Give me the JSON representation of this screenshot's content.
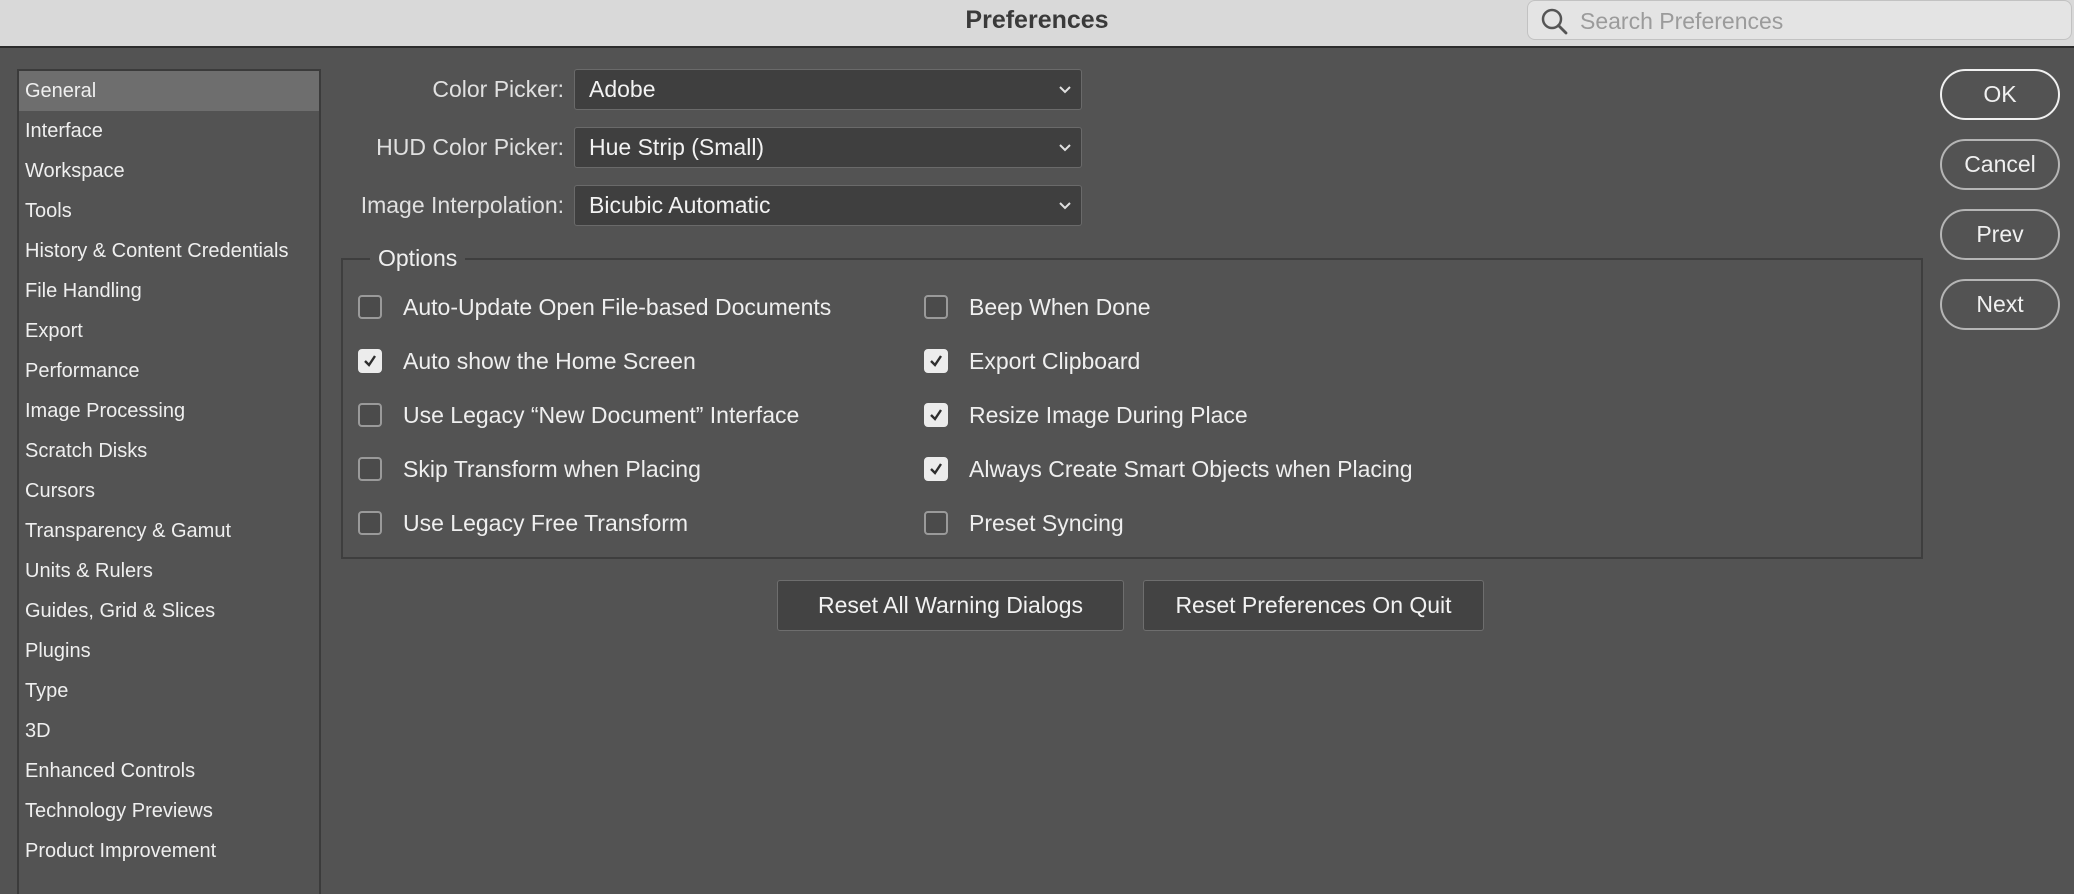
{
  "window": {
    "title": "Preferences"
  },
  "search": {
    "placeholder": "Search Preferences",
    "value": ""
  },
  "sidebar": {
    "items": [
      {
        "label": "General",
        "selected": true
      },
      {
        "label": "Interface"
      },
      {
        "label": "Workspace"
      },
      {
        "label": "Tools"
      },
      {
        "label": "History & Content Credentials"
      },
      {
        "label": "File Handling"
      },
      {
        "label": "Export"
      },
      {
        "label": "Performance"
      },
      {
        "label": "Image Processing"
      },
      {
        "label": "Scratch Disks"
      },
      {
        "label": "Cursors"
      },
      {
        "label": "Transparency & Gamut"
      },
      {
        "label": "Units & Rulers"
      },
      {
        "label": "Guides, Grid & Slices"
      },
      {
        "label": "Plugins"
      },
      {
        "label": "Type"
      },
      {
        "label": "3D"
      },
      {
        "label": "Enhanced Controls"
      },
      {
        "label": "Technology Previews"
      },
      {
        "label": "Product Improvement"
      }
    ]
  },
  "fields": {
    "color_picker": {
      "label": "Color Picker:",
      "value": "Adobe"
    },
    "hud_color_picker": {
      "label": "HUD Color Picker:",
      "value": "Hue Strip (Small)"
    },
    "image_interpolation": {
      "label": "Image Interpolation:",
      "value": "Bicubic Automatic"
    }
  },
  "options": {
    "title": "Options",
    "left": [
      {
        "label": "Auto-Update Open File-based Documents",
        "checked": false
      },
      {
        "label": "Auto show the Home Screen",
        "checked": true
      },
      {
        "label": "Use Legacy “New Document” Interface",
        "checked": false
      },
      {
        "label": "Skip Transform when Placing",
        "checked": false
      },
      {
        "label": "Use Legacy Free Transform",
        "checked": false
      }
    ],
    "right": [
      {
        "label": "Beep When Done",
        "checked": false
      },
      {
        "label": "Export Clipboard",
        "checked": true
      },
      {
        "label": "Resize Image During Place",
        "checked": true
      },
      {
        "label": "Always Create Smart Objects when Placing",
        "checked": true
      },
      {
        "label": "Preset Syncing",
        "checked": false
      }
    ]
  },
  "reset": {
    "warning_dialogs": "Reset All Warning Dialogs",
    "preferences_on_quit": "Reset Preferences On Quit"
  },
  "buttons": {
    "ok": "OK",
    "cancel": "Cancel",
    "prev": "Prev",
    "next": "Next"
  }
}
